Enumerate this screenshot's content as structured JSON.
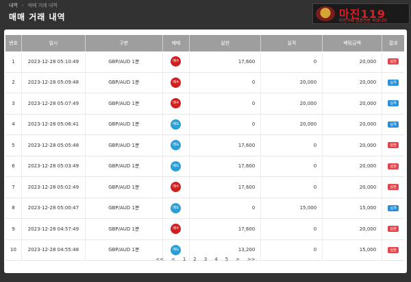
{
  "breadcrumb": {
    "home": "내역",
    "separator": "›",
    "current": "매매 거래 내역"
  },
  "page_title": "매매 거래 내역",
  "logo": {
    "brand": "마진",
    "suffix": "119",
    "tagline": "마진거래 검증전문 커뮤니티"
  },
  "table": {
    "headers": [
      "번호",
      "일시",
      "구분",
      "매매",
      "실현",
      "실격",
      "베팅금액",
      "결과"
    ],
    "rows": [
      {
        "no": "1",
        "date": "2023-12-28 05:10:49",
        "pair": "GBP/AUD 1분",
        "side": "매수",
        "side_color": "#d01f1f",
        "profit": "17,600",
        "loss": "0",
        "bet": "20,000",
        "result": "실현",
        "result_color": "#e0474c"
      },
      {
        "no": "2",
        "date": "2023-12-28 05:09:48",
        "pair": "GBP/AUD 1분",
        "side": "매수",
        "side_color": "#d01f1f",
        "profit": "0",
        "loss": "20,000",
        "bet": "20,000",
        "result": "실격",
        "result_color": "#2a8fd6"
      },
      {
        "no": "3",
        "date": "2023-12-28 05:07:49",
        "pair": "GBP/AUD 1분",
        "side": "매수",
        "side_color": "#d01f1f",
        "profit": "0",
        "loss": "20,000",
        "bet": "20,000",
        "result": "실격",
        "result_color": "#2a8fd6"
      },
      {
        "no": "4",
        "date": "2023-12-28 05:06:41",
        "pair": "GBP/AUD 1분",
        "side": "매도",
        "side_color": "#2a9fd6",
        "profit": "0",
        "loss": "20,000",
        "bet": "20,000",
        "result": "실격",
        "result_color": "#2a8fd6"
      },
      {
        "no": "5",
        "date": "2023-12-28 05:05:48",
        "pair": "GBP/AUD 1분",
        "side": "매도",
        "side_color": "#2a9fd6",
        "profit": "17,600",
        "loss": "0",
        "bet": "20,000",
        "result": "실현",
        "result_color": "#e0474c"
      },
      {
        "no": "6",
        "date": "2023-12-28 05:03:49",
        "pair": "GBP/AUD 1분",
        "side": "매도",
        "side_color": "#2a9fd6",
        "profit": "17,600",
        "loss": "0",
        "bet": "20,000",
        "result": "실현",
        "result_color": "#e0474c"
      },
      {
        "no": "7",
        "date": "2023-12-28 05:02:49",
        "pair": "GBP/AUD 1분",
        "side": "매수",
        "side_color": "#d01f1f",
        "profit": "17,600",
        "loss": "0",
        "bet": "20,000",
        "result": "실현",
        "result_color": "#e0474c"
      },
      {
        "no": "8",
        "date": "2023-12-28 05:00:47",
        "pair": "GBP/AUD 1분",
        "side": "매도",
        "side_color": "#2a9fd6",
        "profit": "0",
        "loss": "15,000",
        "bet": "15,000",
        "result": "실격",
        "result_color": "#2a8fd6"
      },
      {
        "no": "9",
        "date": "2023-12-28 04:57:49",
        "pair": "GBP/AUD 1분",
        "side": "매수",
        "side_color": "#d01f1f",
        "profit": "17,600",
        "loss": "0",
        "bet": "20,000",
        "result": "실현",
        "result_color": "#e0474c"
      },
      {
        "no": "10",
        "date": "2023-12-28 04:55:48",
        "pair": "GBP/AUD 1분",
        "side": "매도",
        "side_color": "#2a9fd6",
        "profit": "13,200",
        "loss": "0",
        "bet": "15,000",
        "result": "실현",
        "result_color": "#e0474c"
      }
    ]
  },
  "pagination": {
    "first": "<<",
    "prev": "<",
    "pages": [
      "1",
      "2",
      "3",
      "4",
      "5"
    ],
    "next": ">",
    "last": ">>"
  }
}
